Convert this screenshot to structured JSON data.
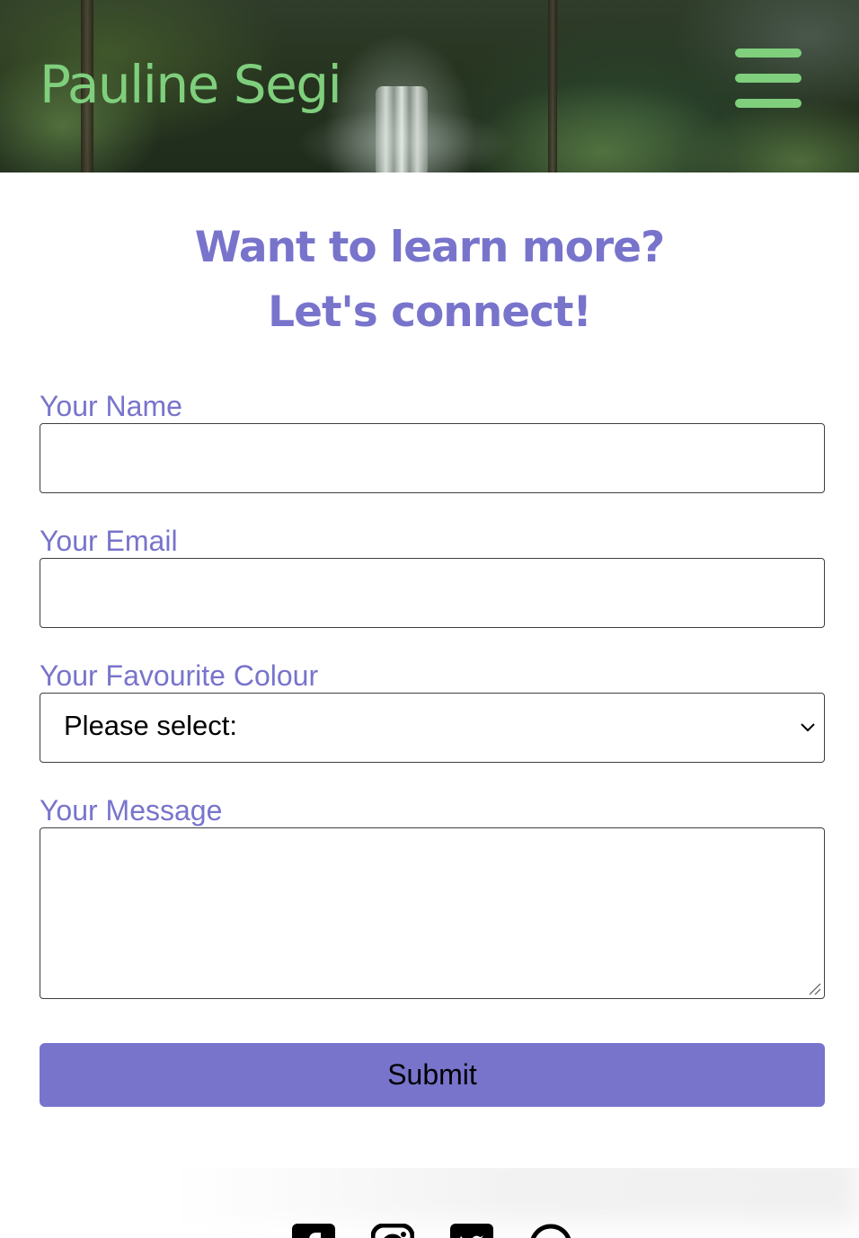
{
  "site": {
    "logo_text": "Pauline Segi",
    "menu_icon": "hamburger-menu-icon"
  },
  "headline": {
    "line1": "Want to learn more?",
    "line2": "Let's connect!"
  },
  "form": {
    "name_label": "Your Name",
    "name_value": "",
    "email_label": "Your Email",
    "email_value": "",
    "colour_label": "Your Favourite Colour",
    "colour_selected": "Please select:",
    "message_label": "Your Message",
    "message_value": "",
    "submit_label": "Submit"
  },
  "footer": {
    "social_icons": [
      "facebook-icon",
      "instagram-icon",
      "twitter-icon",
      "message-icon"
    ]
  },
  "colors": {
    "brand_green": "#7fcf7d",
    "accent_purple": "#7874cc"
  }
}
